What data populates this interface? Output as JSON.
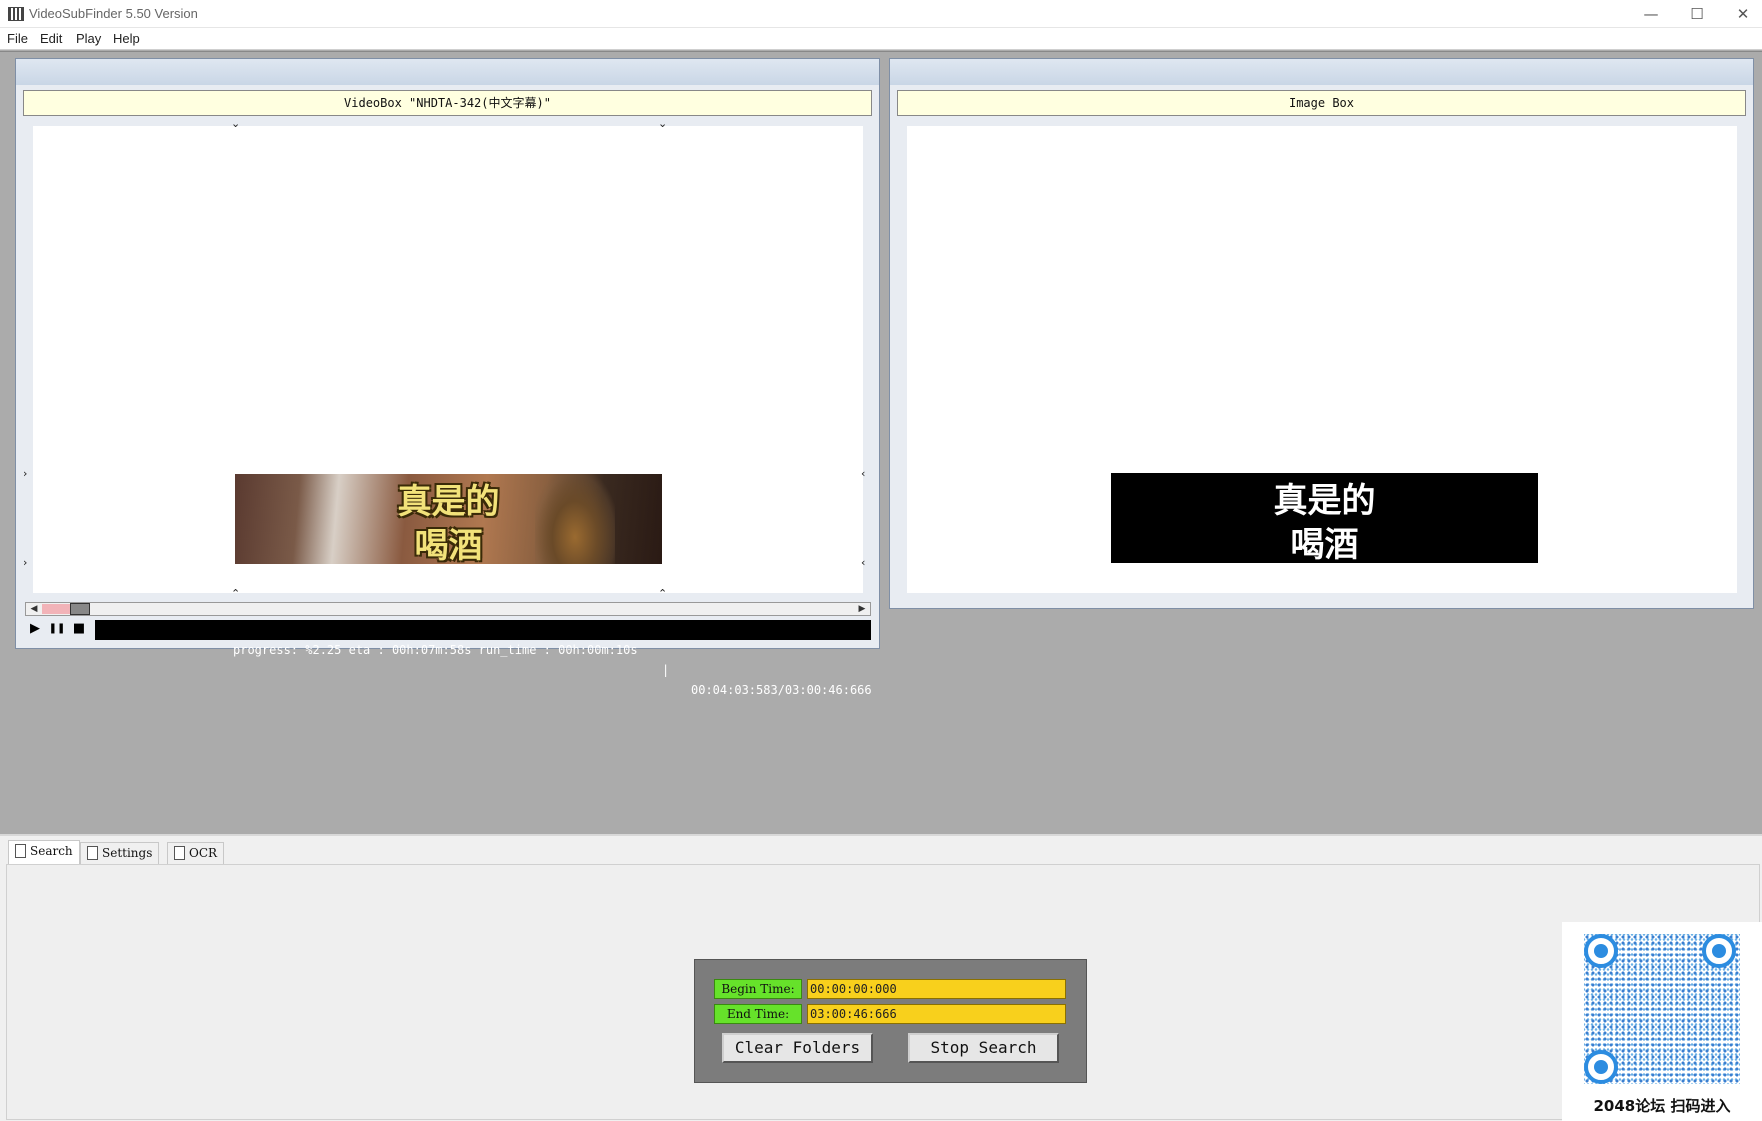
{
  "app": {
    "title": "VideoSubFinder 5.50 Version",
    "window_controls": {
      "minimize": "—",
      "maximize": "☐",
      "close": "✕"
    }
  },
  "menu": [
    "File",
    "Edit",
    "Play",
    "Help"
  ],
  "video_box": {
    "caption": "VideoBox \"NHDTA-342(中文字幕)\"",
    "subtitle_line1": "真是的",
    "subtitle_line2": "喝酒",
    "progress_fraction": 0.0225
  },
  "image_box": {
    "caption": "Image Box",
    "subtitle_line1": "真是的",
    "subtitle_line2": "喝酒"
  },
  "status": {
    "progress_text": "progress: %2.25 eta : 00h:07m:58s run_time : 00h:00m:10s",
    "separator": "|",
    "time_text": "00:04:03:583/03:00:46:666"
  },
  "controls": {
    "play": "▶",
    "pause": "❚❚",
    "stop": "■"
  },
  "tabs": [
    {
      "label": "Search",
      "active": true
    },
    {
      "label": "Settings",
      "active": false
    },
    {
      "label": "OCR",
      "active": false
    }
  ],
  "search_panel": {
    "begin_label": "Begin Time:",
    "begin_value": "00:00:00:000",
    "end_label": "End Time:",
    "end_value": "03:00:46:666",
    "clear_button": "Clear Folders",
    "stop_button": "Stop Search"
  },
  "qr": {
    "caption": "2048论坛 扫码进入"
  },
  "colors": {
    "caption_bg": "#ffffe0",
    "label_green": "#66e22a",
    "input_yellow": "#f8d01c",
    "subtitle_yellow": "#f2e27a",
    "qr_blue": "#2c8ce0"
  }
}
